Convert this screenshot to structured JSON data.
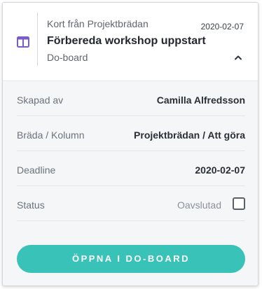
{
  "header": {
    "source_label": "Kort från Projektbrädan",
    "date": "2020-02-07",
    "title": "Förbereda workshop uppstart",
    "app_name": "Do-board",
    "icon": "board-columns-icon",
    "expand_icon": "chevron-up-icon"
  },
  "details": {
    "created_by": {
      "label": "Skapad av",
      "value": "Camilla Alfredsson"
    },
    "board_column": {
      "label": "Bräda / Kolumn",
      "value": "Projektbrädan / Att göra"
    },
    "deadline": {
      "label": "Deadline",
      "value": "2020-02-07"
    },
    "status": {
      "label": "Status",
      "value": "Oavslutad",
      "checked": false
    }
  },
  "actions": {
    "open_label": "ÖPPNA I DO-BOARD"
  },
  "colors": {
    "accent": "#39c2b8",
    "icon": "#7b5cc7",
    "background": "#f4f6f8"
  }
}
